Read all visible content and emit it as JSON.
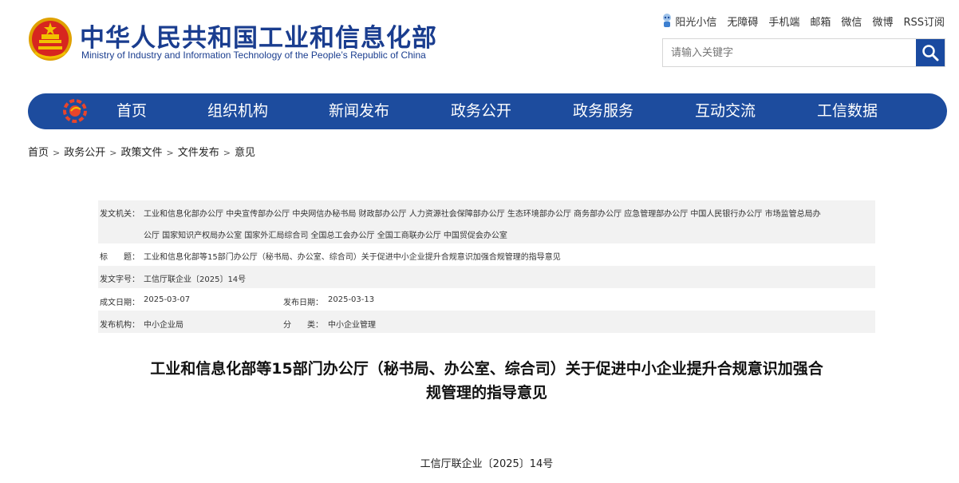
{
  "header": {
    "site_title_cn": "中华人民共和国工业和信息化部",
    "site_title_en": "Ministry of Industry and Information Technology of the People’s Republic of China",
    "emblem_icon": "national-emblem-icon",
    "links": [
      "阳光小信",
      "无障碍",
      "手机端",
      "邮箱",
      "微信",
      "微博",
      "RSS订阅"
    ],
    "search": {
      "placeholder": "请输入关键字",
      "icon": "search-icon"
    }
  },
  "nav": {
    "logo_icon": "miit-logo-icon",
    "items": [
      "首页",
      "组织机构",
      "新闻发布",
      "政务公开",
      "政务服务",
      "互动交流",
      "工信数据"
    ]
  },
  "breadcrumb": [
    "首页",
    "政务公开",
    "政策文件",
    "文件发布",
    "意见"
  ],
  "meta": {
    "issuer_label": "发文机关：",
    "issuer_line1": "工业和信息化部办公厅 中央宣传部办公厅 中央网信办秘书局 财政部办公厅 人力资源社会保障部办公厅 生态环境部办公厅 商务部办公厅 应急管理部办公厅 中国人民银行办公厅 市场监管总局办",
    "issuer_line2": "公厅 国家知识产权局办公室 国家外汇局综合司 全国总工会办公厅 全国工商联办公厅 中国贸促会办公室",
    "title_label": "标　　题：",
    "title_value": "工业和信息化部等15部门办公厅（秘书局、办公室、综合司）关于促进中小企业提升合规意识加强合规管理的指导意见",
    "docno_label": "发文字号：",
    "docno_value": "工信厅联企业〔2025〕14号",
    "written_label": "成文日期：",
    "written_value": "2025-03-07",
    "published_label": "发布日期：",
    "published_value": "2025-03-13",
    "org_label": "发布机构：",
    "org_value": "中小企业局",
    "category_label": "分　　类：",
    "category_value": "中小企业管理"
  },
  "article": {
    "title_line1": "工业和信息化部等15部门办公厅（秘书局、办公室、综合司）关于促进中小企业提升合规意识加强合",
    "title_line2": "规管理的指导意见",
    "doc_number": "工信厅联企业〔2025〕14号"
  },
  "colors": {
    "brand_blue": "#1d4c9e",
    "emblem_red": "#d7261f",
    "emblem_gold": "#f2c200"
  }
}
